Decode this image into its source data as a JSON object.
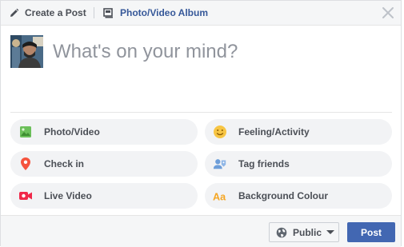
{
  "header": {
    "create_post_label": "Create a Post",
    "album_label": "Photo/Video Album"
  },
  "composer": {
    "placeholder": "What's on your mind?"
  },
  "options": [
    {
      "label": "Photo/Video",
      "icon": "photo-video-icon",
      "color": "#45bd62"
    },
    {
      "label": "Feeling/Activity",
      "icon": "smiley-icon",
      "color": "#f7b928"
    },
    {
      "label": "Check in",
      "icon": "location-pin-icon",
      "color": "#f5533d"
    },
    {
      "label": "Tag friends",
      "icon": "tag-friends-icon",
      "color": "#1877f2"
    },
    {
      "label": "Live Video",
      "icon": "live-video-icon",
      "color": "#f02849"
    },
    {
      "label": "Background Colour",
      "icon": "background-colour-icon",
      "color": "#f5a623"
    }
  ],
  "footer": {
    "privacy_label": "Public",
    "post_label": "Post"
  },
  "colors": {
    "brand": "#4267b2",
    "link": "#365899"
  }
}
